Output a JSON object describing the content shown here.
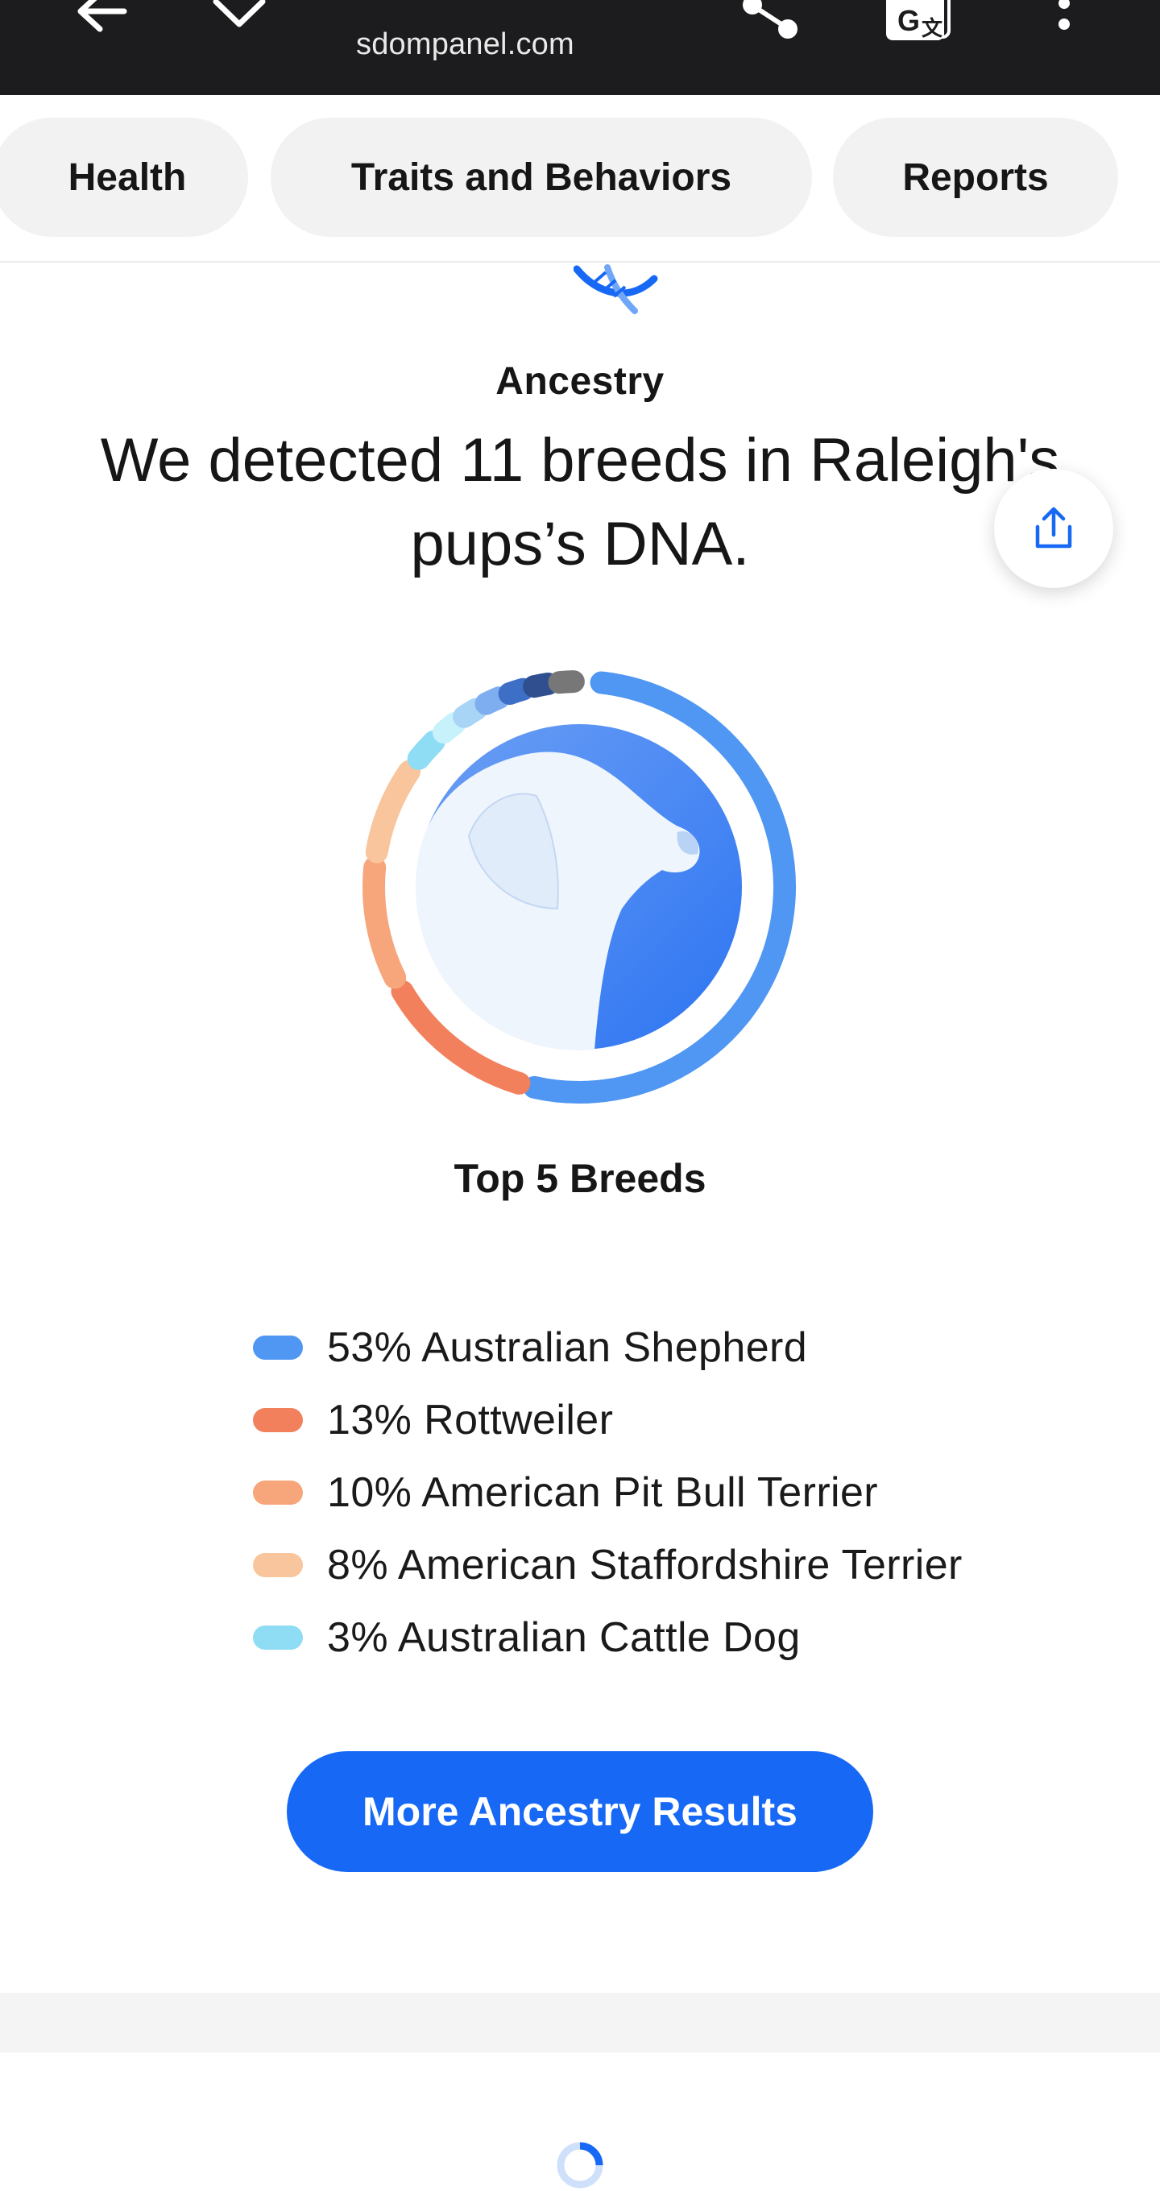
{
  "browser": {
    "url": "sdompanel.com"
  },
  "tabs": [
    {
      "label": "Health"
    },
    {
      "label": "Traits and Behaviors"
    },
    {
      "label": "Reports"
    }
  ],
  "ancestry": {
    "section_label": "Ancestry",
    "headline": "We detected 11 breeds in Raleigh's\npups’s DNA.",
    "top_breeds_title": "Top 5 Breeds",
    "legend": [
      {
        "text": "53% Australian Shepherd",
        "color": "#4f97f2"
      },
      {
        "text": "13% Rottweiler",
        "color": "#f2805c"
      },
      {
        "text": "10% American Pit Bull Terrier",
        "color": "#f7a57b"
      },
      {
        "text": "8% American Staffordshire Terrier",
        "color": "#f8c59c"
      },
      {
        "text": "3% Australian Cattle Dog",
        "color": "#8fdcf5"
      }
    ],
    "more_button_label": "More Ancestry Results"
  },
  "chart_data": {
    "type": "pie",
    "categories": [
      "Australian Shepherd",
      "Rottweiler",
      "American Pit Bull Terrier",
      "American Staffordshire Terrier",
      "Australian Cattle Dog"
    ],
    "values": [
      53,
      13,
      10,
      8,
      3
    ],
    "unit": "%"
  },
  "colors": {
    "accent": "#1668f5",
    "topbar": "#1c1c1e"
  }
}
